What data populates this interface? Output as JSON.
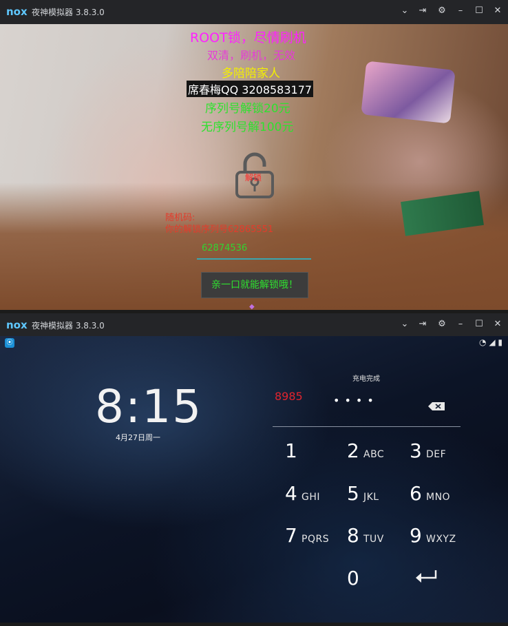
{
  "window1": {
    "logo": "nox",
    "title": "夜神模拟器 3.8.3.0",
    "controls": [
      "chevron-down-icon",
      "pin-icon",
      "gear-icon",
      "minimize-icon",
      "maximize-icon",
      "close-icon"
    ],
    "ransom": {
      "line1": "ROOT锁，尽情刷机",
      "line2": "双清，刷机，无效",
      "line3": "多陪陪家人",
      "line4": "席春梅QQ 3208583177",
      "line5": "序列号解锁20元",
      "line6": "无序列号解100元",
      "lock_label": "解锁",
      "random_label": "随机码:",
      "serial_line": "你的解锁序列号62865551",
      "input_value": "62874536",
      "button_label": "亲一口就能解锁哦！"
    },
    "colors": {
      "magenta": "#ff21ff",
      "yellow": "#f4f000",
      "green": "#2fe12f",
      "red": "#e33b2b"
    }
  },
  "window2": {
    "logo": "nox",
    "title": "夜神模拟器 3.8.3.0",
    "controls": [
      "chevron-down-icon",
      "pin-icon",
      "gear-icon",
      "minimize-icon",
      "maximize-icon",
      "close-icon"
    ],
    "status_icons": [
      "app-icon",
      "wifi-icon",
      "signal-icon",
      "battery-icon"
    ],
    "lockscreen": {
      "time": "8:15",
      "date": "4月27日周一",
      "charge_status": "充电完成",
      "typed_value": "8985",
      "pin_dots": "••••",
      "keys": [
        {
          "num": "1",
          "letters": ""
        },
        {
          "num": "2",
          "letters": "ABC"
        },
        {
          "num": "3",
          "letters": "DEF"
        },
        {
          "num": "4",
          "letters": "GHI"
        },
        {
          "num": "5",
          "letters": "JKL"
        },
        {
          "num": "6",
          "letters": "MNO"
        },
        {
          "num": "7",
          "letters": "PQRS"
        },
        {
          "num": "8",
          "letters": "TUV"
        },
        {
          "num": "9",
          "letters": "WXYZ"
        },
        {
          "num": "0",
          "letters": ""
        }
      ]
    }
  }
}
